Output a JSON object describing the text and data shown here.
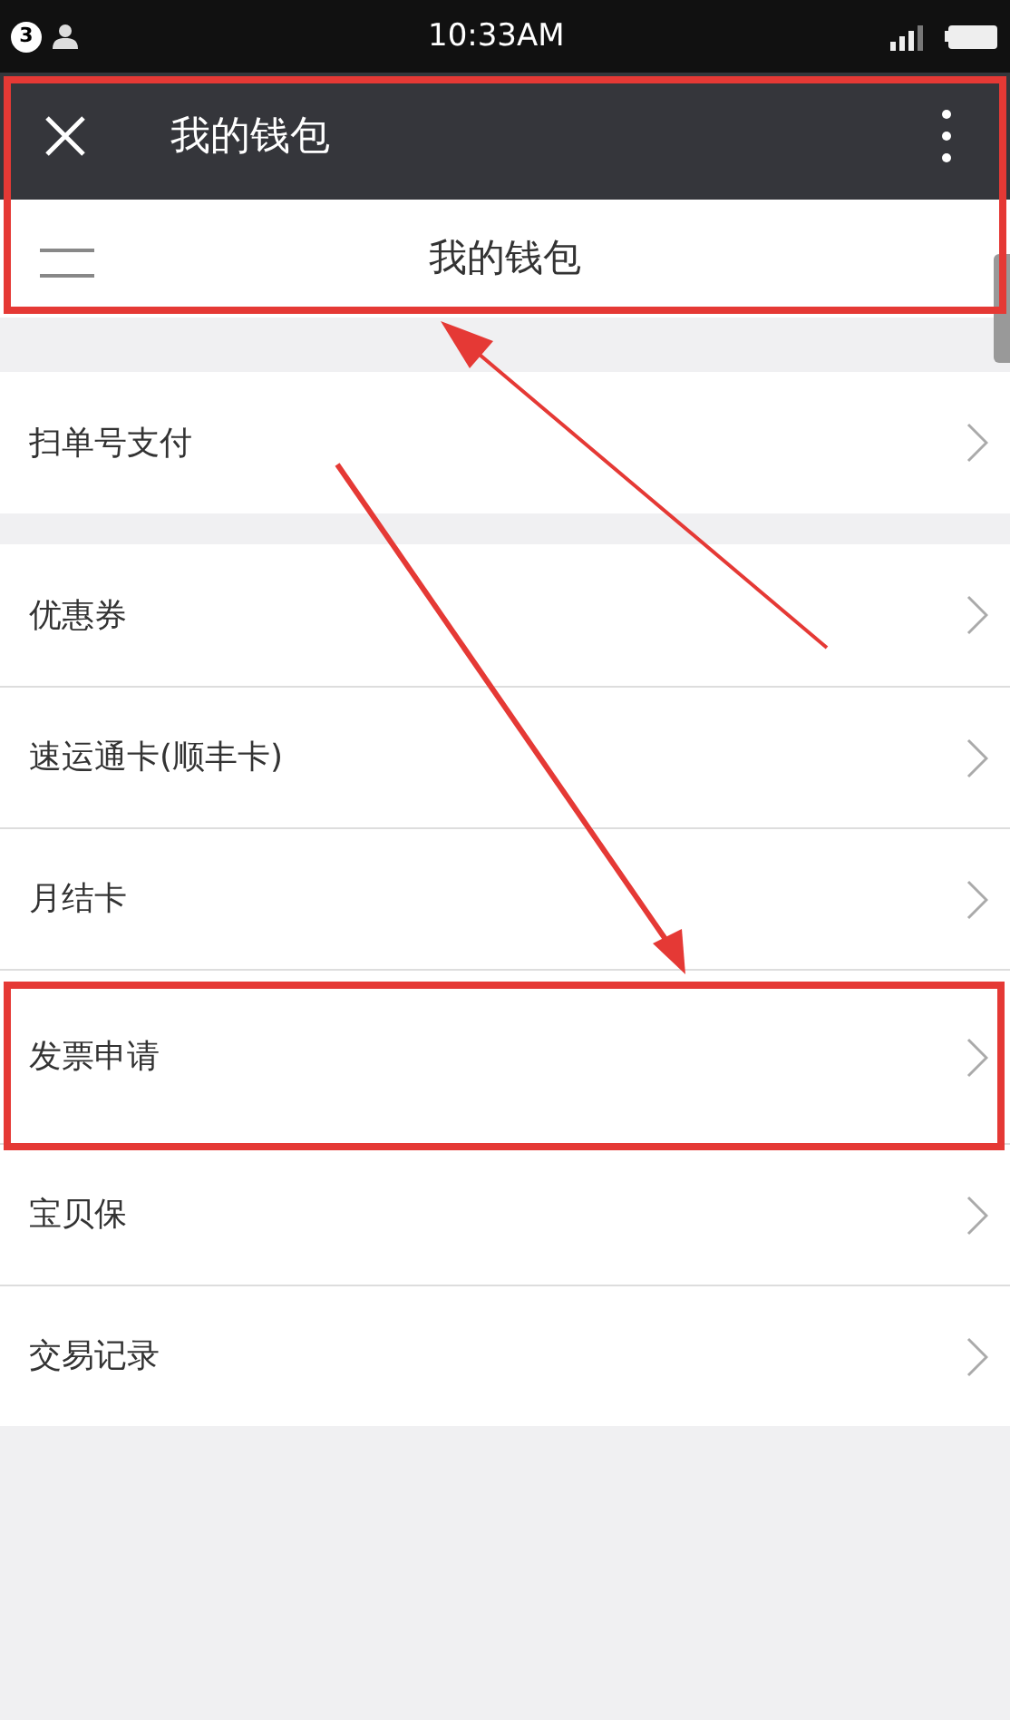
{
  "status_bar": {
    "notification_count": "3",
    "time": "10:33AM"
  },
  "nav_bar": {
    "title": "我的钱包",
    "highlighted": true
  },
  "page_header": {
    "title": "我的钱包"
  },
  "sections": [
    {
      "items": [
        {
          "label": "扫单号支付",
          "highlighted": false
        }
      ]
    },
    {
      "items": [
        {
          "label": "优惠券",
          "highlighted": false
        },
        {
          "label": "速运通卡(顺丰卡)",
          "highlighted": false
        },
        {
          "label": "月结卡",
          "highlighted": false
        },
        {
          "label": "发票申请",
          "highlighted": true
        },
        {
          "label": "宝贝保",
          "highlighted": false
        },
        {
          "label": "交易记录",
          "highlighted": false
        }
      ]
    }
  ]
}
